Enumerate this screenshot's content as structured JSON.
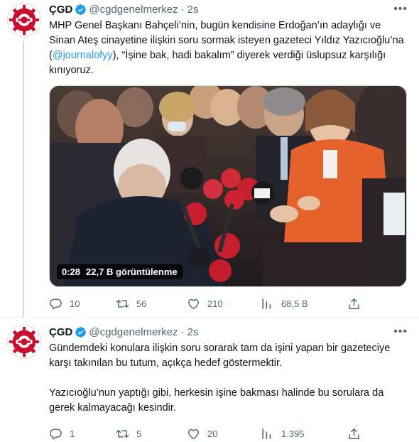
{
  "tweets": [
    {
      "name": "ÇGD",
      "handle": "@cgdgenelmerkez",
      "dot": "·",
      "time": "2s",
      "text_html": "MHP Genel Başkanı Bahçeli’nin, bugün kendisine Erdoğan’ın adaylığı ve Sinan Ateş cinayetine ilişkin soru sormak isteyen gazeteci Yıldız Yazıcıoğlu’na (<span class=\"mention\" data-name=\"mention-link\" data-interactable=\"true\">@journalofyy</span>), “İşine bak, hadi bakalım” diyerek verdiği üslupsuz karşılığı kınıyoruz.",
      "video": {
        "duration": "0:28",
        "views": "22,7 B görüntülenme"
      },
      "stats": {
        "replies": "10",
        "retweets": "56",
        "likes": "210",
        "views": "68,5 B"
      }
    },
    {
      "name": "ÇGD",
      "handle": "@cgdgenelmerkez",
      "dot": "·",
      "time": "2s",
      "paragraph1": "Gündemdeki konulara ilişkin soru sorarak tam da işini yapan bir gazeteciye karşı takınılan bu tutum, açıkça hedef göstermektir.",
      "paragraph2": "Yazıcıoğlu’nun yaptığı gibi, herkesin işine bakması halinde bu sorulara da gerek kalmayacağı kesindir.",
      "stats": {
        "replies": "1",
        "retweets": "5",
        "likes": "20",
        "views": "1.395"
      }
    }
  ],
  "colors": {
    "brand_red": "#c8102e",
    "verified_blue": "#1d9bf0",
    "mention_blue": "#1d9bf0",
    "muted_text": "#536471"
  },
  "icons": {
    "verified": "verified-badge-icon",
    "more": "more-icon",
    "reply": "reply-icon",
    "retweet": "retweet-icon",
    "like": "like-icon",
    "views": "views-icon",
    "share": "share-icon"
  }
}
